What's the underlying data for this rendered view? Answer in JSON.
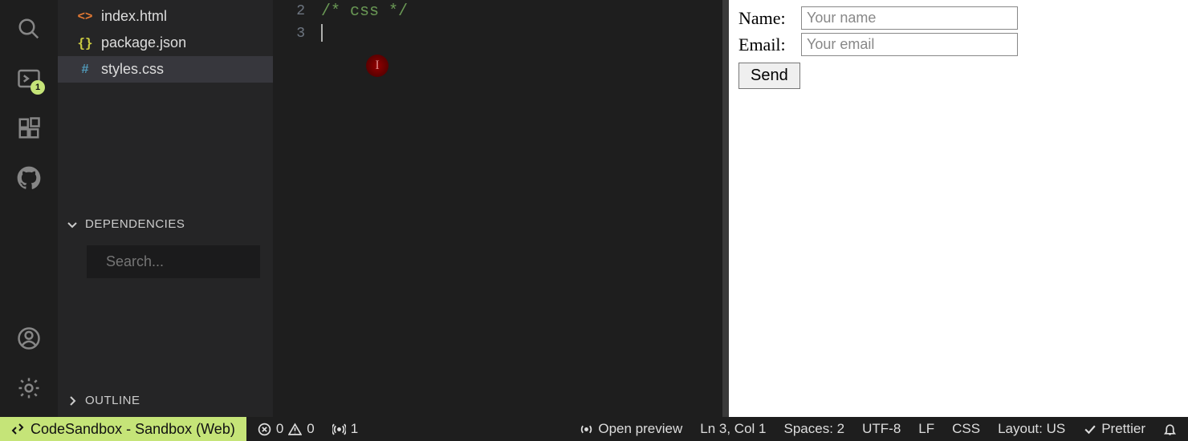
{
  "activitybar": {
    "terminal_badge": "1"
  },
  "sidebar": {
    "files": [
      {
        "icon": "<>",
        "label": "index.html",
        "cls": "fi-orange",
        "active": false
      },
      {
        "icon": "{}",
        "label": "package.json",
        "cls": "fi-yellow",
        "active": false
      },
      {
        "icon": "#",
        "label": "styles.css",
        "cls": "fi-blue",
        "active": true
      }
    ],
    "dependencies_label": "DEPENDENCIES",
    "search_placeholder": "Search...",
    "outline_label": "OUTLINE"
  },
  "editor": {
    "lines": [
      {
        "num": "2",
        "text": "/* css */",
        "cls": "comment"
      },
      {
        "num": "3",
        "text": "",
        "cursor": true
      }
    ],
    "click_marker_glyph": "I"
  },
  "preview": {
    "name_label": "Name:",
    "name_placeholder": "Your name",
    "email_label": "Email:",
    "email_placeholder": "Your email",
    "send_label": "Send"
  },
  "statusbar": {
    "remote_label": "CodeSandbox - Sandbox (Web)",
    "errors": "0",
    "warnings": "0",
    "ports": "1",
    "open_preview": "Open preview",
    "position": "Ln 3, Col 1",
    "spaces": "Spaces: 2",
    "encoding": "UTF-8",
    "eol": "LF",
    "lang": "CSS",
    "layout": "Layout: US",
    "prettier": "Prettier"
  }
}
